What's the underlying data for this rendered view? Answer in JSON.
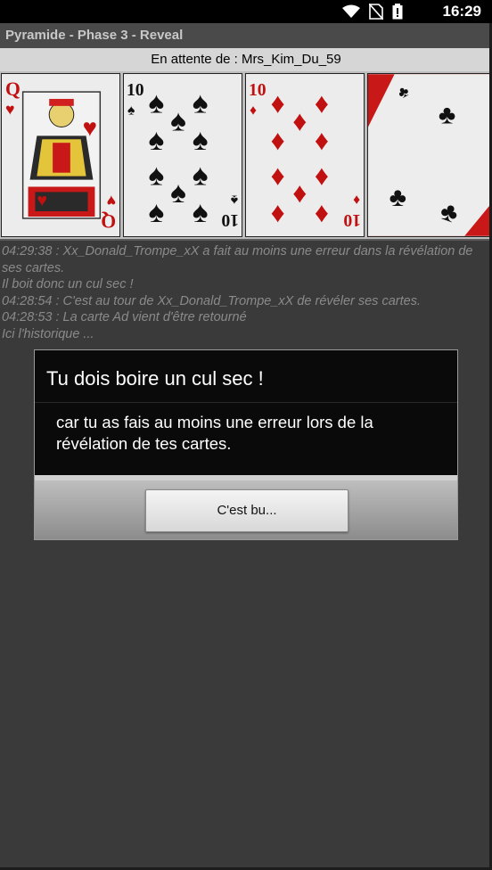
{
  "status_bar": {
    "time": "16:29",
    "icons": [
      "wifi-icon",
      "no-sim-icon",
      "battery-icon"
    ]
  },
  "title_bar": {
    "title": "Pyramide - Phase 3 - Reveal"
  },
  "waiting": {
    "text": "En attente de : Mrs_Kim_Du_59"
  },
  "cards": [
    {
      "rank": "Q",
      "suit": "hearts",
      "suit_symbol": "♥",
      "color": "#d01010"
    },
    {
      "rank": "10",
      "suit": "spades",
      "suit_symbol": "♠",
      "color": "#111111"
    },
    {
      "rank": "10",
      "suit": "diamonds",
      "suit_symbol": "♦",
      "color": "#d01010"
    },
    {
      "rank": "",
      "suit": "clubs",
      "suit_symbol": "♣",
      "color": "#111111"
    }
  ],
  "history": {
    "lines": [
      "04:29:38 : Xx_Donald_Trompe_xX a fait au moins une erreur dans la révélation de ses cartes.",
      "Il boit donc un cul sec !",
      "04:28:54 : C'est au tour de Xx_Donald_Trompe_xX de révéler ses cartes.",
      "04:28:53 : La carte Ad vient d'être retourné",
      "Ici l'historique ..."
    ]
  },
  "dialog": {
    "title": "Tu dois boire un cul sec !",
    "message": "car tu as fais au moins une erreur lors de la révélation de tes cartes.",
    "button_label": "C'est bu..."
  }
}
